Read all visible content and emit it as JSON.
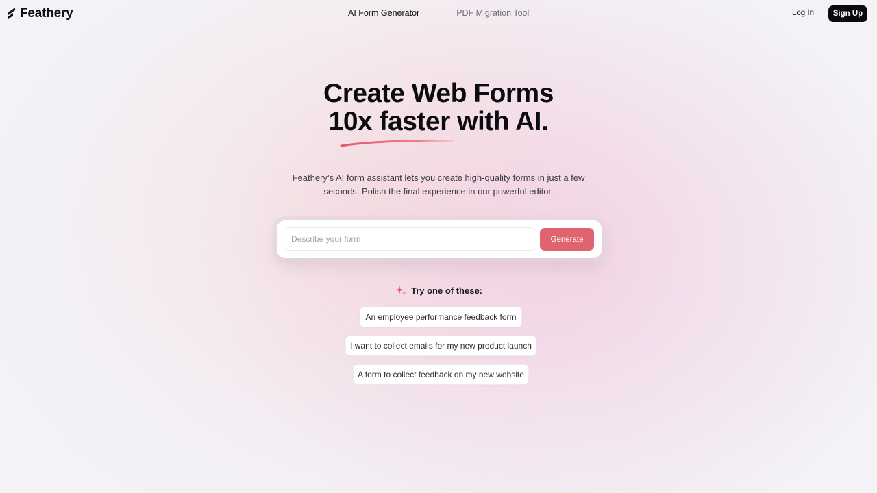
{
  "brand": {
    "name": "Feathery",
    "logo_icon": "feather-logo-icon"
  },
  "nav": {
    "items": [
      {
        "label": "AI Form Generator",
        "active": true
      },
      {
        "label": "PDF Migration Tool",
        "active": false
      }
    ]
  },
  "auth": {
    "login_label": "Log In",
    "signup_label": "Sign Up"
  },
  "hero": {
    "headline_line1": "Create Web Forms",
    "headline_line2": "10x faster with AI.",
    "subtitle": "Feathery’s AI form assistant lets you create high-quality forms in just a few seconds. Polish the final experience in our powerful editor.",
    "accent_color": "#e8566a"
  },
  "prompt": {
    "placeholder": "Describe your form",
    "value": "",
    "generate_label": "Generate",
    "button_color": "#e06470"
  },
  "suggestions": {
    "heading": "Try one of these:",
    "icon": "sparkle-icon",
    "items": [
      "An employee performance feedback form",
      "I want to collect emails for my new product launch",
      "A form to collect feedback on my new website"
    ]
  }
}
